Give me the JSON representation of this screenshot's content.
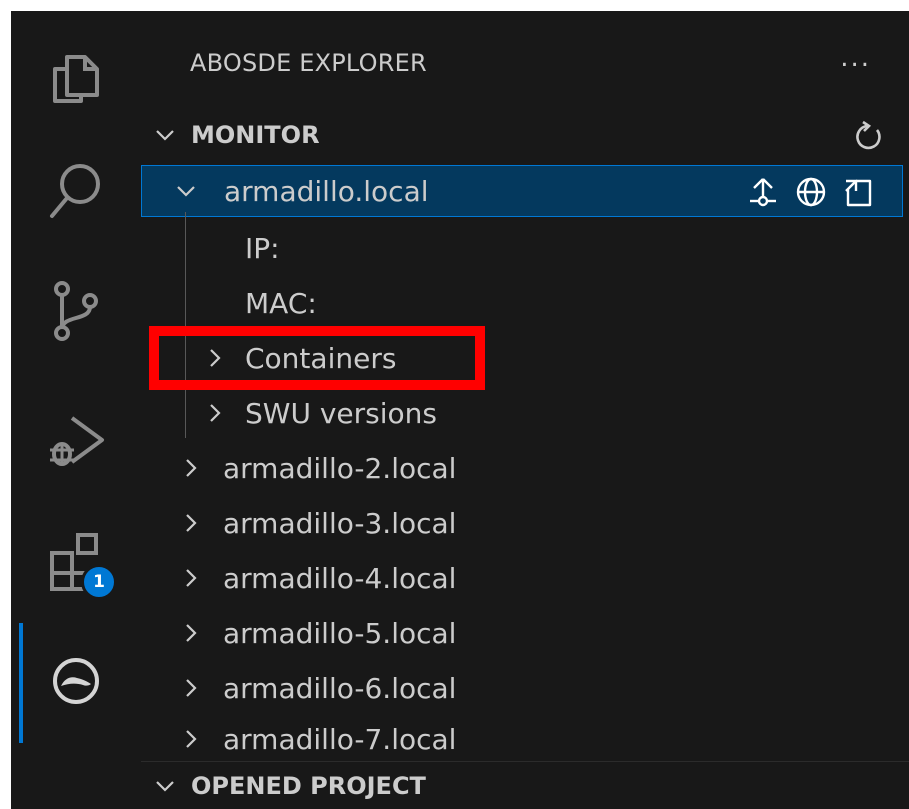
{
  "activity_bar": {
    "items": [
      {
        "icon": "explorer-icon"
      },
      {
        "icon": "search-icon"
      },
      {
        "icon": "source-control-icon"
      },
      {
        "icon": "run-debug-icon"
      },
      {
        "icon": "extensions-icon",
        "badge": "1"
      },
      {
        "icon": "abosde-icon",
        "active": true
      }
    ]
  },
  "sidebar": {
    "title": "ABOSDE EXPLORER",
    "more_label": "...",
    "monitor": {
      "label": "MONITOR",
      "devices": [
        {
          "name": "armadillo.local",
          "expanded": true,
          "selected": true,
          "children": [
            {
              "label": "IP:"
            },
            {
              "label": "MAC:"
            },
            {
              "label": "Containers",
              "collapsible": true,
              "highlighted": true
            },
            {
              "label": "SWU versions",
              "collapsible": true
            }
          ]
        },
        {
          "name": "armadillo-2.local"
        },
        {
          "name": "armadillo-3.local"
        },
        {
          "name": "armadillo-4.local"
        },
        {
          "name": "armadillo-5.local"
        },
        {
          "name": "armadillo-6.local"
        },
        {
          "name": "armadillo-7.local"
        }
      ]
    },
    "opened_project": {
      "label": "OPENED PROJECT"
    }
  },
  "colors": {
    "background": "#181818",
    "selected_row": "#04395e",
    "selected_border": "#0078d4",
    "badge": "#0078d4",
    "highlight_box": "#ff0000",
    "text": "#cccccc"
  }
}
